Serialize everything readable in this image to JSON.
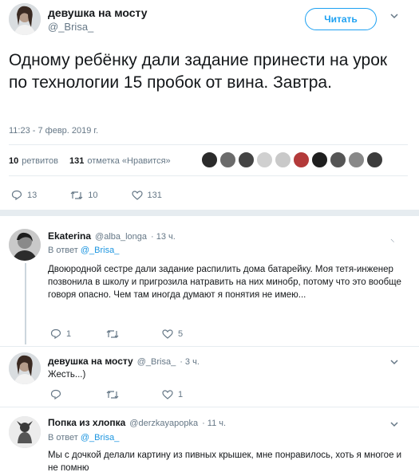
{
  "main_tweet": {
    "display_name": "девушка на мосту",
    "handle": "@_Brisa_",
    "follow_label": "Читать",
    "text": "Одному ребёнку дали задание принести на урок по технологии 15 пробок от вина. Завтра.",
    "timestamp": "11:23 - 7 февр. 2019 г.",
    "retweets_count": "10",
    "retweets_label": "ретвитов",
    "likes_count": "131",
    "likes_label": "отметка «Нравится»",
    "action_reply": "13",
    "action_retweet": "10",
    "action_like": "131"
  },
  "replies": [
    {
      "display_name": "Ekaterina",
      "handle": "@alba_longa",
      "time": "· 13 ч.",
      "reply_to_label": "В ответ",
      "reply_to_handle": "@_Brisa_",
      "text": "Двоюродной сестре дали задание распилить дома батарейку. Моя тетя-инженер позвонила в школу и пригрозила натравить на них минобр, потому что это вообще говоря опасно. Чем там иногда думают я понятия не имею...",
      "reply_count": "1",
      "retweet_count": "",
      "like_count": "5"
    },
    {
      "display_name": "девушка на мосту",
      "handle": "@_Brisa_",
      "time": "· 3 ч.",
      "text": "Жесть...)",
      "reply_count": "",
      "retweet_count": "",
      "like_count": "1"
    },
    {
      "display_name": "Попка из хлопка",
      "handle": "@derzkayapopka",
      "time": "· 11 ч.",
      "reply_to_label": "В ответ",
      "reply_to_handle": "@_Brisa_",
      "text": "Мы с дочкой делали картину из пивных крышек, мне понравилось, хоть я многое и не помню"
    }
  ],
  "colors": {
    "accent": "#1da1f2",
    "link": "#1b95e0",
    "secondary_text": "#657786",
    "divider": "#e6ecf0"
  }
}
